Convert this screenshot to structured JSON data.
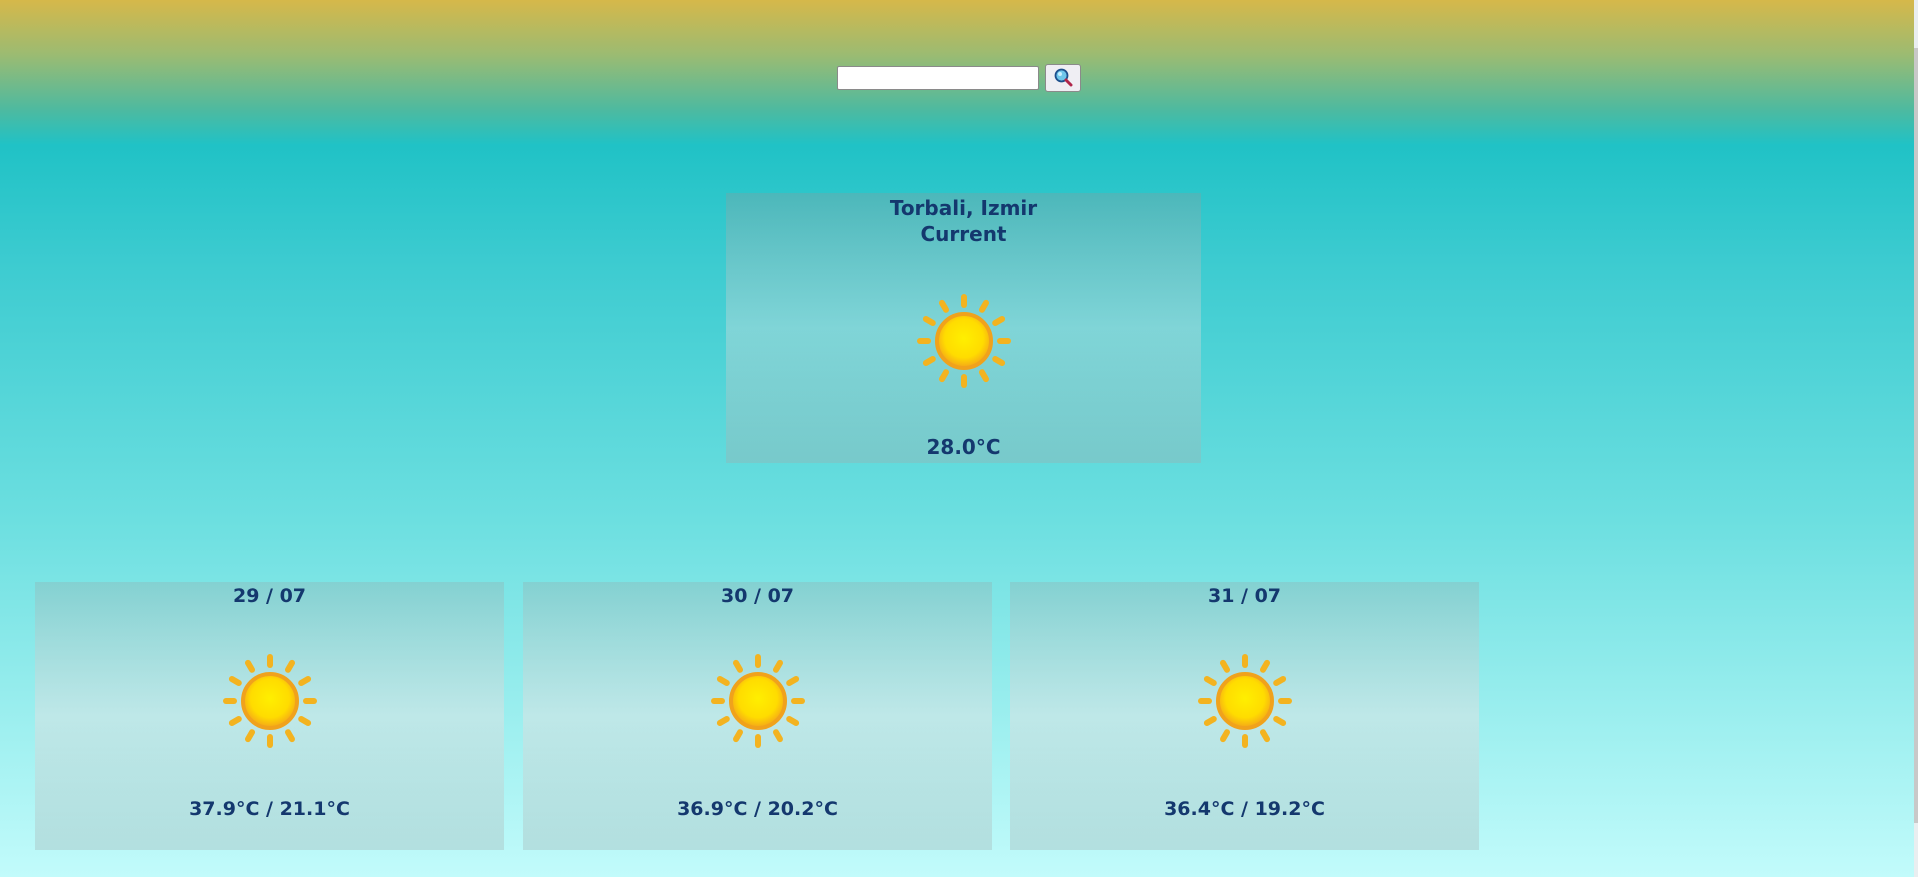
{
  "search": {
    "placeholder": "",
    "value": "",
    "button_icon": "magnifier-icon"
  },
  "current": {
    "city": "Torbali, Izmir",
    "label": "Current",
    "icon": "sun-icon",
    "temperature": "28.0°C"
  },
  "forecast": [
    {
      "date": "29 / 07",
      "icon": "sun-icon",
      "temps": "37.9°C / 21.1°C"
    },
    {
      "date": "30 / 07",
      "icon": "sun-icon",
      "temps": "36.9°C / 20.2°C"
    },
    {
      "date": "31 / 07",
      "icon": "sun-icon",
      "temps": "36.4°C / 19.2°C"
    }
  ],
  "colors": {
    "text": "#14386e",
    "sun_ray": "#f3b320",
    "sun_core": "#ffe500"
  }
}
